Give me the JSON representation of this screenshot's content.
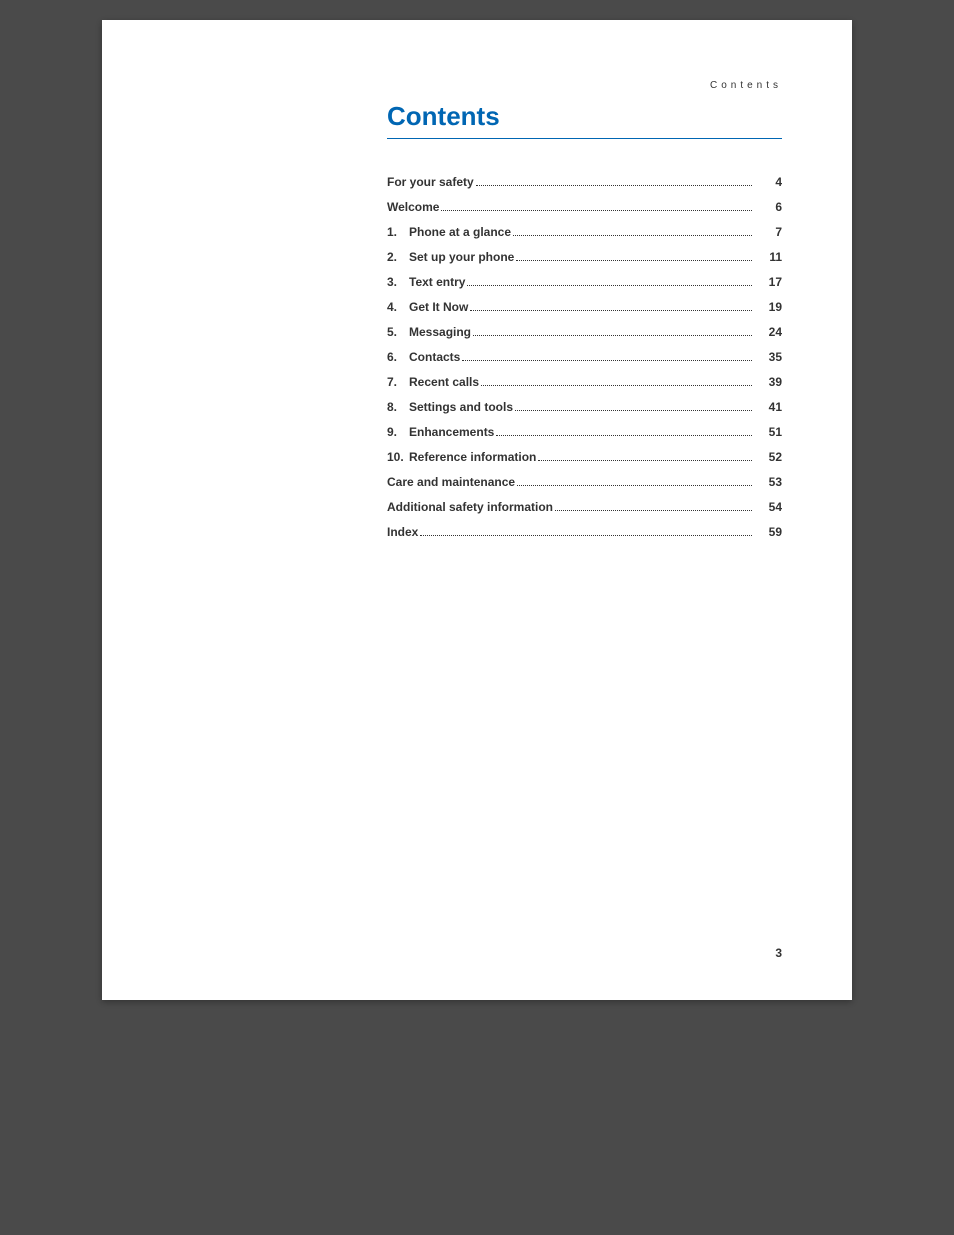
{
  "header": "Contents",
  "title": "Contents",
  "pageNumber": "3",
  "toc": [
    {
      "num": "",
      "title": "For your safety",
      "page": "4"
    },
    {
      "num": "",
      "title": "Welcome",
      "page": "6"
    },
    {
      "num": "1.",
      "title": "Phone at a glance",
      "page": "7"
    },
    {
      "num": "2.",
      "title": "Set up your phone",
      "page": "11"
    },
    {
      "num": "3.",
      "title": "Text entry",
      "page": "17"
    },
    {
      "num": "4.",
      "title": "Get It Now",
      "page": "19"
    },
    {
      "num": "5.",
      "title": "Messaging",
      "page": "24"
    },
    {
      "num": "6.",
      "title": "Contacts",
      "page": "35"
    },
    {
      "num": "7.",
      "title": "Recent calls",
      "page": "39"
    },
    {
      "num": "8.",
      "title": "Settings and tools",
      "page": "41"
    },
    {
      "num": "9.",
      "title": "Enhancements",
      "page": "51"
    },
    {
      "num": "10.",
      "title": "Reference information",
      "page": "52"
    },
    {
      "num": "",
      "title": "Care and maintenance",
      "page": "53"
    },
    {
      "num": "",
      "title": "Additional safety information",
      "page": "54"
    },
    {
      "num": "",
      "title": "Index",
      "page": "59"
    }
  ]
}
